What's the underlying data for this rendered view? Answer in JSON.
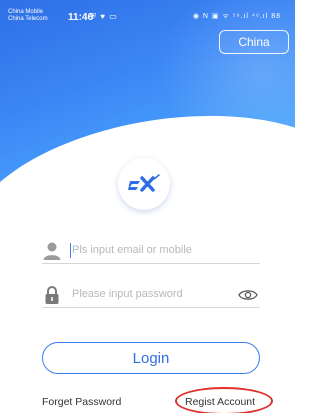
{
  "status_bar": {
    "carrier1": "China Mobile",
    "carrier2": "China Telecom",
    "time": "11:46",
    "right_icons": "◉ N ▣ ᯤ ⁵⁶.ıl ⁴⁶.ıl 88"
  },
  "region": {
    "label": "China"
  },
  "login_form": {
    "email_placeholder": "Pls input email or mobile",
    "password_placeholder": "Please input password",
    "login_label": "Login"
  },
  "links": {
    "forget_password": "Forget Password",
    "register": "Regist Account"
  },
  "colors": {
    "primary": "#3b7cf0",
    "highlight_ring": "#e0302b"
  },
  "icons": [
    "user-icon",
    "lock-icon",
    "eye-icon",
    "sx-logo-icon"
  ]
}
